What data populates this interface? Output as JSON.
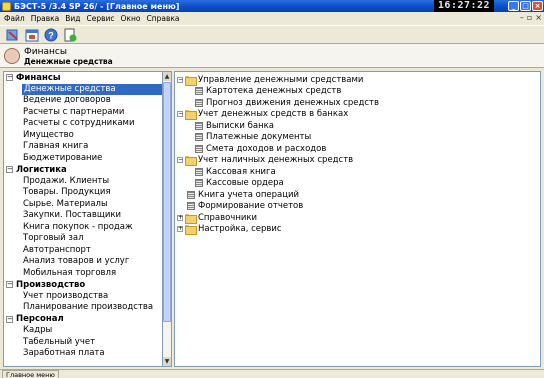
{
  "window": {
    "title": "БЭСТ-5 /3.4 SP 26/ - [Главное меню]",
    "clock": "16:27:22"
  },
  "menu": [
    "Файл",
    "Правка",
    "Вид",
    "Сервис",
    "Окно",
    "Справка"
  ],
  "header": {
    "title": "Финансы",
    "subtitle": "Денежные средства"
  },
  "left_tree": {
    "groups": [
      {
        "label": "Финансы",
        "items": [
          "Денежные средства",
          "Ведение договоров",
          "Расчеты с партнерами",
          "Расчеты с сотрудниками",
          "Имущество",
          "Главная книга",
          "Бюджетирование"
        ]
      },
      {
        "label": "Логистика",
        "items": [
          "Продажи. Клиенты",
          "Товары. Продукция",
          "Сырье. Материалы",
          "Закупки. Поставщики",
          "Книга покупок - продаж",
          "Торговый зал",
          "Автотранспорт",
          "Анализ товаров и услуг",
          "Мобильная торговля"
        ]
      },
      {
        "label": "Производство",
        "items": [
          "Учет производства",
          "Планирование производства"
        ]
      },
      {
        "label": "Персонал",
        "items": [
          "Кадры",
          "Табельный учет",
          "Заработная плата"
        ]
      }
    ],
    "selected": "Денежные средства"
  },
  "right_tree": {
    "nodes": [
      {
        "label": "Управление денежными средствами",
        "type": "folder",
        "expander": "-",
        "level": 0
      },
      {
        "label": "Картотека денежных средств",
        "type": "doc",
        "level": 1
      },
      {
        "label": "Прогноз движения денежных средств",
        "type": "doc",
        "level": 1
      },
      {
        "label": "Учет денежных средств в банках",
        "type": "folder",
        "expander": "-",
        "level": 0
      },
      {
        "label": "Выписки банка",
        "type": "doc",
        "level": 1
      },
      {
        "label": "Платежные документы",
        "type": "doc",
        "level": 1
      },
      {
        "label": "Смета доходов и расходов",
        "type": "doc",
        "level": 1
      },
      {
        "label": "Учет наличных денежных средств",
        "type": "folder",
        "expander": "-",
        "level": 0
      },
      {
        "label": "Кассовая книга",
        "type": "doc",
        "level": 1
      },
      {
        "label": "Кассовые ордера",
        "type": "doc",
        "level": 1
      },
      {
        "label": "Книга учета операций",
        "type": "doc",
        "level": 0
      },
      {
        "label": "Формирование отчетов",
        "type": "doc",
        "level": 0
      },
      {
        "label": "Справочники",
        "type": "folder",
        "expander": "+",
        "level": 0
      },
      {
        "label": "Настройка, сервис",
        "type": "folder",
        "expander": "+",
        "level": 0
      }
    ]
  },
  "status": {
    "text": "Главное меню"
  }
}
